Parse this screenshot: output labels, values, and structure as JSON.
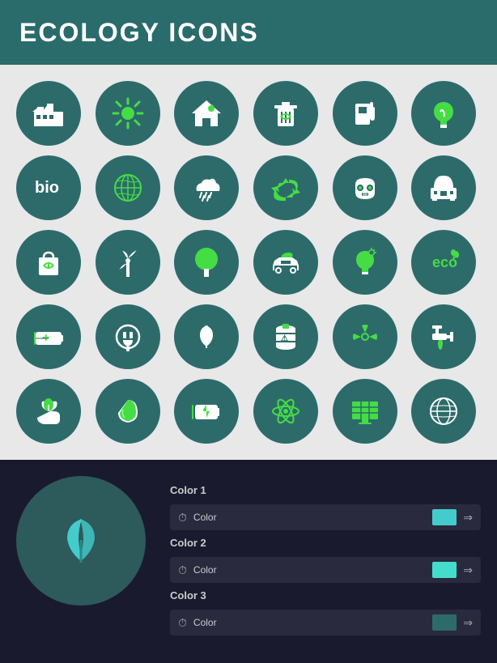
{
  "header": {
    "title": "ECOLOGY ICONS",
    "background": "#2a6b6b"
  },
  "icons": [
    {
      "name": "factory-icon",
      "label": "Factory"
    },
    {
      "name": "sun-icon",
      "label": "Sun/Solar"
    },
    {
      "name": "eco-house-icon",
      "label": "Eco House"
    },
    {
      "name": "recycle-bin-icon",
      "label": "Recycle Bin"
    },
    {
      "name": "fuel-pump-icon",
      "label": "Fuel Pump"
    },
    {
      "name": "eco-bulb-icon",
      "label": "Eco Bulb"
    },
    {
      "name": "bio-icon",
      "label": "Bio"
    },
    {
      "name": "earth-icon",
      "label": "Earth"
    },
    {
      "name": "rain-cloud-icon",
      "label": "Rain Cloud"
    },
    {
      "name": "recycle-icon",
      "label": "Recycle"
    },
    {
      "name": "gas-mask-icon",
      "label": "Gas Mask"
    },
    {
      "name": "nuclear-plant-icon",
      "label": "Nuclear Plant"
    },
    {
      "name": "recycle-bag-icon",
      "label": "Recycle Bag"
    },
    {
      "name": "wind-turbine-icon",
      "label": "Wind Turbine"
    },
    {
      "name": "tree-icon",
      "label": "Tree"
    },
    {
      "name": "eco-car-icon",
      "label": "Eco Car"
    },
    {
      "name": "eco-light-icon",
      "label": "Eco Light"
    },
    {
      "name": "eco-text-icon",
      "label": "Eco Text"
    },
    {
      "name": "battery-icon",
      "label": "Battery"
    },
    {
      "name": "plug-icon",
      "label": "Plug"
    },
    {
      "name": "leaf-icon",
      "label": "Leaf"
    },
    {
      "name": "barrel-icon",
      "label": "Barrel"
    },
    {
      "name": "radiation-icon",
      "label": "Radiation"
    },
    {
      "name": "faucet-icon",
      "label": "Faucet"
    },
    {
      "name": "hand-leaf-icon",
      "label": "Hand with Leaf"
    },
    {
      "name": "water-drop-icon",
      "label": "Water Drop"
    },
    {
      "name": "eco-battery-icon",
      "label": "Eco Battery"
    },
    {
      "name": "atom-icon",
      "label": "Atom"
    },
    {
      "name": "solar-panel-icon",
      "label": "Solar Panel"
    },
    {
      "name": "globe-icon",
      "label": "Globe"
    }
  ],
  "color_controls": {
    "color1_label": "Color 1",
    "color1_name": "Color",
    "color1_swatch": "#44cccc",
    "color2_label": "Color 2",
    "color2_name": "Color",
    "color2_swatch": "#44ddcc",
    "color3_label": "Color 3",
    "color3_name": "Color",
    "color3_swatch": "#2d6b6b"
  }
}
